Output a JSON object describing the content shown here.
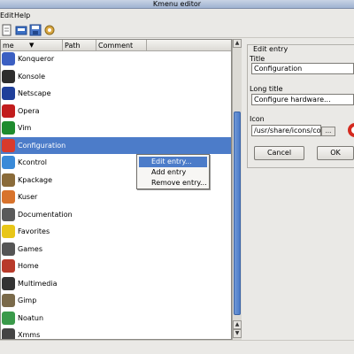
{
  "window": {
    "title": "Kmenu editor"
  },
  "menubar": {
    "items": [
      "Edit",
      "Help"
    ]
  },
  "toolbar": {
    "buttons": [
      "new-icon",
      "open-icon",
      "save-icon",
      "settings-icon"
    ]
  },
  "tree": {
    "columns": [
      "me",
      "Path",
      "Comment"
    ],
    "rows": [
      {
        "label": "Konqueror",
        "icon": "konqueror-icon",
        "color": "#3b5fc2"
      },
      {
        "label": "Konsole",
        "icon": "konsole-icon",
        "color": "#2d2d2d"
      },
      {
        "label": "Netscape",
        "icon": "netscape-icon",
        "color": "#1f3f9a"
      },
      {
        "label": "Opera",
        "icon": "opera-icon",
        "color": "#c21d1d"
      },
      {
        "label": "Vim",
        "icon": "vim-icon",
        "color": "#1e8b2e"
      },
      {
        "label": "Configuration",
        "icon": "configuration-icon",
        "color": "#d83a2c"
      },
      {
        "label": "Kcontrol",
        "icon": "kcontrol-icon",
        "color": "#3a8ad8"
      },
      {
        "label": "Kpackage",
        "icon": "kpackage-icon",
        "color": "#8a6b3a"
      },
      {
        "label": "Kuser",
        "icon": "kuser-icon",
        "color": "#d8732c"
      },
      {
        "label": "Documentation",
        "icon": "documentation-icon",
        "color": "#5a5a5a"
      },
      {
        "label": "Favorites",
        "icon": "favorites-icon",
        "color": "#e8c618"
      },
      {
        "label": "Games",
        "icon": "games-icon",
        "color": "#555"
      },
      {
        "label": "Home",
        "icon": "home-icon",
        "color": "#b83a2a"
      },
      {
        "label": "Multimedia",
        "icon": "multimedia-icon",
        "color": "#333"
      },
      {
        "label": "Gimp",
        "icon": "gimp-icon",
        "color": "#7a6a4a"
      },
      {
        "label": "Noatun",
        "icon": "noatun-icon",
        "color": "#3a9a4a"
      },
      {
        "label": "Xmms",
        "icon": "xmms-icon",
        "color": "#444"
      }
    ],
    "selected_index": 5
  },
  "context_menu": {
    "items": [
      "Edit entry...",
      "Add entry",
      "Remove entry..."
    ],
    "hover_index": 0
  },
  "edit_panel": {
    "group_title": "Edit entry",
    "title_label": "Title",
    "title_value": "Configuration",
    "long_title_label": "Long title",
    "long_title_value": "Configure hardware...",
    "icon_label": "Icon",
    "icon_value": "/usr/share/icons/confi",
    "browse_label": "...",
    "cancel_label": "Cancel",
    "ok_label": "OK"
  }
}
